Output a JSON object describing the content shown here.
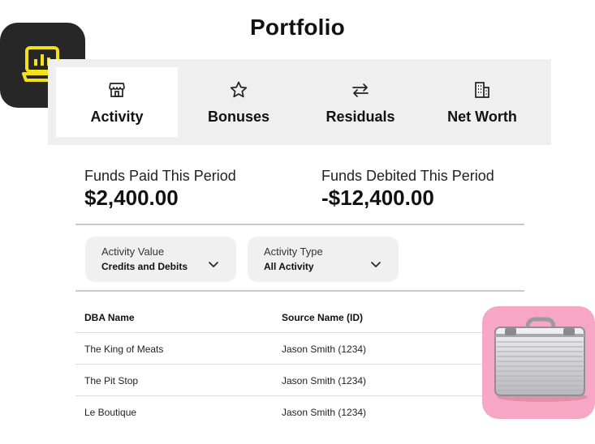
{
  "page": {
    "title": "Portfolio"
  },
  "tabs": [
    {
      "label": "Activity",
      "icon": "storefront-icon",
      "active": true
    },
    {
      "label": "Bonuses",
      "icon": "star-icon",
      "active": false
    },
    {
      "label": "Residuals",
      "icon": "arrows-left-right-icon",
      "active": false
    },
    {
      "label": "Net Worth",
      "icon": "buildings-icon",
      "active": false
    }
  ],
  "metrics": {
    "paid": {
      "label": "Funds Paid This Period",
      "value": "$2,400.00"
    },
    "debited": {
      "label": "Funds Debited This Period",
      "value": "-$12,400.00"
    }
  },
  "filters": {
    "activity_value": {
      "label": "Activity Value",
      "value": "Credits and Debits"
    },
    "activity_type": {
      "label": "Activity Type",
      "value": "All Activity"
    }
  },
  "table": {
    "columns": [
      "DBA Name",
      "Source Name (ID)"
    ],
    "rows": [
      [
        "The King of Meats",
        "Jason Smith (1234)"
      ],
      [
        "The Pit Stop",
        "Jason Smith (1234)"
      ],
      [
        "Le Boutique",
        "Jason Smith (1234)"
      ]
    ]
  },
  "colors": {
    "app_icon_bg": "#272727",
    "app_icon_accent": "#f5e11b",
    "tab_bar_bg": "#efefef",
    "card_pink": "#f7a6c4"
  }
}
